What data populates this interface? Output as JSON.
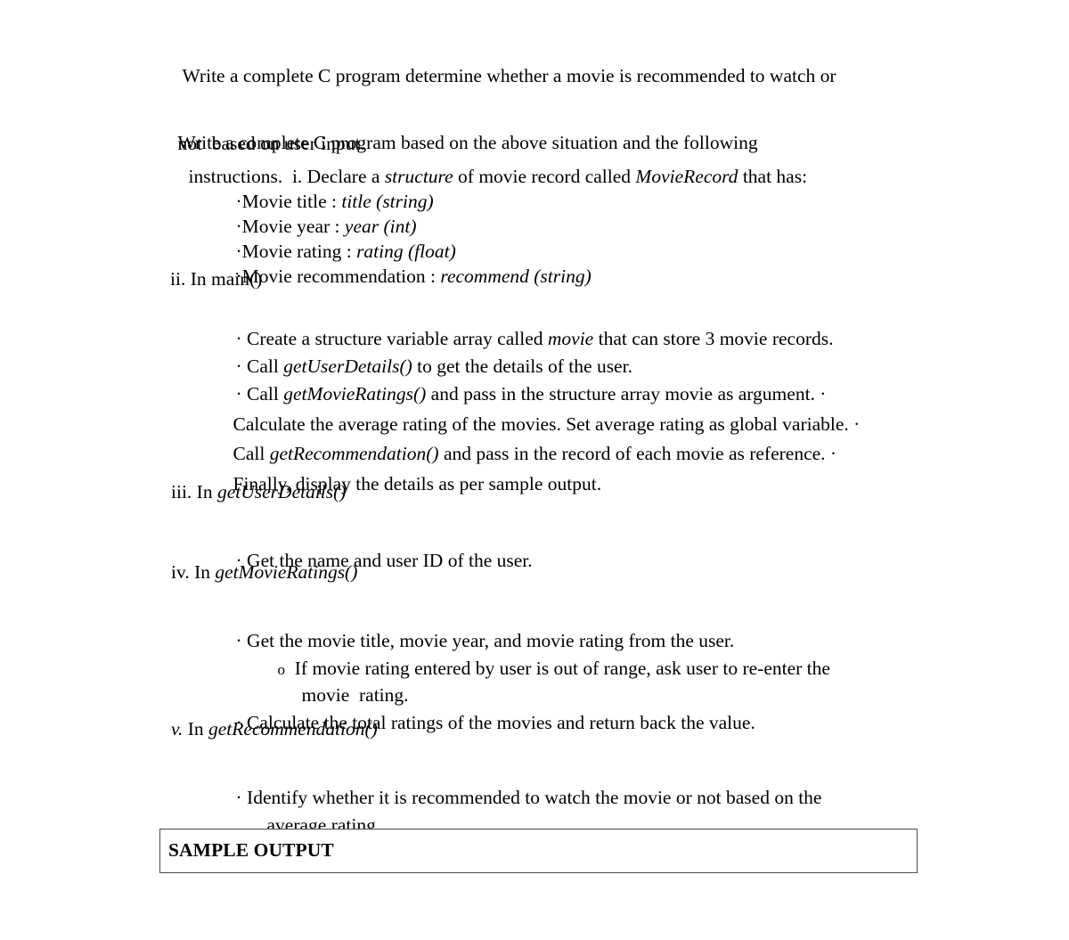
{
  "document": {
    "intro": {
      "paragraph1": "Write a complete C program determine whether a movie is recommended to watch or",
      "paragraph1_line2": "not  based on user input.",
      "paragraph2": "Write a complete C program based on the above situation and the following",
      "paragraph2_line2_prefix": "instructions.  i. Declare a ",
      "paragraph2_line2_italic1": "structure",
      "paragraph2_line2_mid": " of movie record called ",
      "paragraph2_line2_italic2": "MovieRecord",
      "paragraph2_line2_suffix": " that has:"
    },
    "struct_fields": [
      {
        "bullet": "·",
        "label": "Movie title : ",
        "value": "title (string)"
      },
      {
        "bullet": "·",
        "label": "Movie year : ",
        "value": "year (int)"
      },
      {
        "bullet": "·",
        "label": "Movie rating : ",
        "value": "rating (float)"
      },
      {
        "bullet": "·",
        "label": "Movie recommendation : ",
        "value": "recommend (string)"
      }
    ],
    "sections": [
      {
        "numeral": "ii.",
        "keyword": " In ",
        "name": "main()",
        "name_italic": false,
        "lines": [
          {
            "bullet": "·",
            "pre": " Create a structure variable array called ",
            "italic": "movie",
            "post": " that can store 3 movie records."
          },
          {
            "bullet": "·",
            "pre": " Call ",
            "italic": "getUserDetails()",
            "post": " to get the details of the user."
          },
          {
            "bullet": "·",
            "pre": " Call ",
            "italic": "getMovieRatings()",
            "post": " and pass in the structure array movie as argument. ·"
          },
          {
            "bullet": "",
            "pre": "Calculate the average rating of the movies. Set average rating as global variable. ·",
            "italic": "",
            "post": ""
          },
          {
            "bullet": "",
            "pre": "Call ",
            "italic": "getRecommendation()",
            "post": " and pass in the record of each movie as reference. ·"
          },
          {
            "bullet": "",
            "pre": "Finally, display the details as per sample output.",
            "italic": "",
            "post": ""
          }
        ]
      },
      {
        "numeral": "iii.",
        "keyword": " In ",
        "name": "getUserDetails()",
        "name_italic": true,
        "lines": [
          {
            "bullet": "·",
            "pre": " Get the name and user ID of the user.",
            "italic": "",
            "post": ""
          }
        ]
      },
      {
        "numeral": "iv.",
        "keyword": " In ",
        "name": "getMovieRatings()",
        "name_italic": true,
        "lines": [
          {
            "bullet": "·",
            "pre": " Get the movie title, movie year, and movie rating from the user.",
            "italic": "",
            "post": ""
          },
          {
            "bullet": "o",
            "pre": "  If movie rating entered by user is out of range, ask user to re-enter the",
            "italic": "",
            "post": ""
          },
          {
            "bullet": "",
            "pre": "movie  rating.",
            "italic": "",
            "post": ""
          },
          {
            "bullet": "·",
            "pre": " Calculate the total ratings of the movies and return back the value.",
            "italic": "",
            "post": ""
          }
        ]
      },
      {
        "numeral": "v.",
        "numeral_italic": true,
        "keyword": " In ",
        "name": "getRecommendation()",
        "name_italic": true,
        "lines": [
          {
            "bullet": "·",
            "pre": " Identify whether it is recommended to watch the movie or not based on the",
            "italic": "",
            "post": ""
          },
          {
            "bullet": "",
            "pre": "average rating.",
            "italic": "",
            "post": ""
          }
        ]
      }
    ],
    "sample_output": {
      "title": "SAMPLE OUTPUT"
    }
  }
}
